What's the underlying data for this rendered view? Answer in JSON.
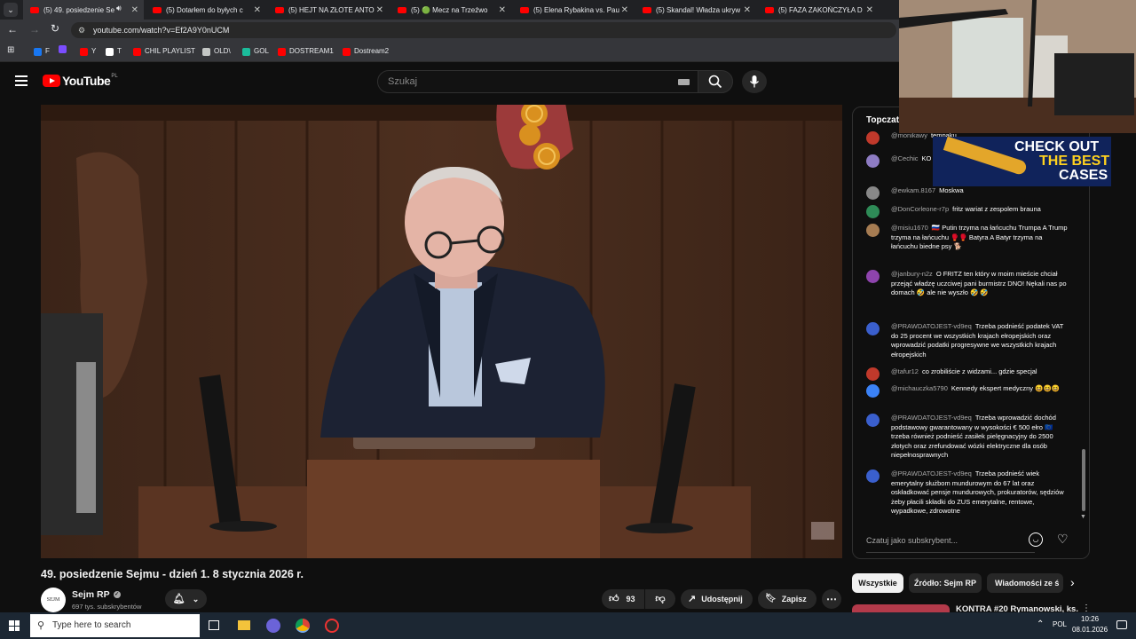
{
  "browser": {
    "tabs": [
      {
        "label": "(5) 49. posiedzenie Se",
        "active": true
      },
      {
        "label": "(5) Dotarłem do byłych c"
      },
      {
        "label": "(5) HEJT NA ZŁOTE ANTO"
      },
      {
        "label": "(5) 🟢 Mecz na Trzeźwo"
      },
      {
        "label": "(5) Elena Rybakina vs. Pau"
      },
      {
        "label": "(5) Skandal! Władza ukryw"
      },
      {
        "label": "(5) FAZA ZAKOŃCZYŁA D"
      }
    ],
    "url": "youtube.com/watch?v=Ef2A9Y0nUCM",
    "bookmarks": [
      {
        "label": "F",
        "color": "#1877f2"
      },
      {
        "label": "",
        "color": "#7b4dff"
      },
      {
        "label": "Y",
        "color": "#ff0000"
      },
      {
        "label": "T",
        "color": "#ffffff"
      },
      {
        "label": "CHIL PLAYLIST",
        "color": "#ff0000"
      },
      {
        "label": "OLD\\",
        "color": "#c4c7c5"
      },
      {
        "label": "GOL",
        "color": "#1bbc9b"
      },
      {
        "label": "DOSTREAM1",
        "color": "#ff0000"
      },
      {
        "label": "Dostream2",
        "color": "#ff0000"
      }
    ]
  },
  "youtube": {
    "logo_text": "YouTube",
    "logo_region": "PL",
    "search_placeholder": "Szukaj"
  },
  "video": {
    "title": "49. posiedzenie Sejmu - dzień 1. 8 stycznia 2026 r."
  },
  "channel": {
    "name": "Sejm RP",
    "subscribers": "697 tys. subskrybentów"
  },
  "actions": {
    "likes": "93",
    "share": "Udostępnij",
    "save": "Zapisz"
  },
  "chat": {
    "header": "Topczat",
    "input_placeholder": "Czatuj jako subskrybent...",
    "messages": [
      {
        "author": "@monikawy",
        "text": "tempaku",
        "color": "#c0392b"
      },
      {
        "author": "@Cechic",
        "text": "KO ❤️",
        "color": "#8e7cc3"
      },
      {
        "author": "@ewkam.8167",
        "text": "Moskwa",
        "color": "#888888"
      },
      {
        "author": "@DonCorleone-r7p",
        "text": "fritz wariat z zespolem brauna",
        "color": "#2e8b57"
      },
      {
        "author": "@misiu1670",
        "text": "🇷🇺 Putin trzyma na łańcuchu Trumpa A Trump trzyma na łańcuchu 🥊🥊 Batyra A Batyr trzyma na łańcuchu biedne psy 🐕",
        "color": "#a67c52"
      },
      {
        "author": "@janbury-n2z",
        "text": "O FRITZ ten który w moim mieście chciał przejąć władzę uczciwej pani burmistrz DNO! Nękali nas po domach 🤣 ale nie wyszło 🤣 🤣",
        "color": "#8e44ad"
      },
      {
        "author": "@PRAWDATOJEST-vd9eq",
        "text": "Trzeba podnieść podatek VAT do 25 procent we wszystkich krajach ełropejskich oraz wprowadzić podatki progresywne we wszystkich krajach ełropejskich",
        "color": "#3a5fcd"
      },
      {
        "author": "@tafur12",
        "text": "co zrobiliście z widzami... gdzie specjal",
        "color": "#c0392b"
      },
      {
        "author": "@michauczka5790",
        "text": "Kennedy ekspert medyczny 😆😆😆",
        "color": "#3b82f6"
      },
      {
        "author": "@PRAWDATOJEST-vd9eq",
        "text": "Trzeba wprowadzić dochód podstawowy gwarantowany w wysokości € 500 ełro 🇪🇺 trzeba również podnieść zasiłek pielęgnacyjny do 2500 złotych oraz zrefundować wózki elektryczne dla osób niepełnosprawnych",
        "color": "#3a5fcd"
      },
      {
        "author": "@PRAWDATOJEST-vd9eq",
        "text": "Trzeba podnieść wiek emerytalny służbom mundurowym do 67 lat oraz oskładkować pensje mundurowych, prokuratorów, sędziów żeby płacili składki do ZUS emerytalne, rentowe, wypadkowe, zdrowotne",
        "color": "#3a5fcd"
      }
    ]
  },
  "filters": [
    "Wszystkie",
    "Źródło: Sejm RP",
    "Wiadomości ze ś"
  ],
  "suggested": {
    "title": "KONTRA #20 Rymanowski, ks."
  },
  "overlay": {
    "ad_line1": "CHECK OUT",
    "ad_line2": "THE BEST",
    "ad_line3": "CASES"
  },
  "taskbar": {
    "search_placeholder": "Type here to search",
    "language": "POL",
    "time": "10:26",
    "date": "08.01.2026"
  }
}
